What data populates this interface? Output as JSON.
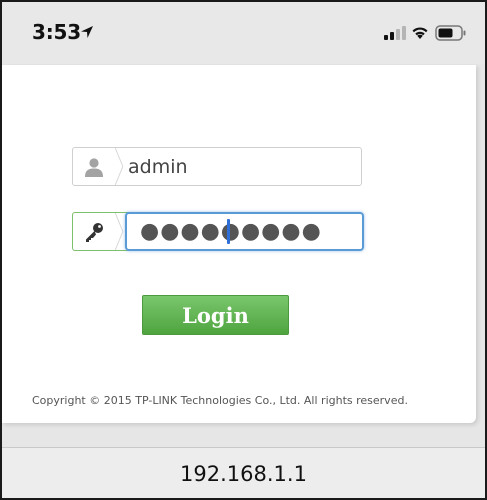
{
  "status_bar": {
    "time": "3:53",
    "icons": [
      "location-arrow-icon",
      "signal-icon",
      "wifi-icon",
      "battery-icon"
    ]
  },
  "login_form": {
    "username_value": "admin",
    "password_value": "●●●●●●●●●",
    "login_label": "Login",
    "accent_color": "#5cb350",
    "focus_color": "#5b9bd5"
  },
  "footer": {
    "copyright": "Copyright © 2015 TP-LINK Technologies Co., Ltd. All rights reserved."
  },
  "browser": {
    "url": "192.168.1.1"
  }
}
